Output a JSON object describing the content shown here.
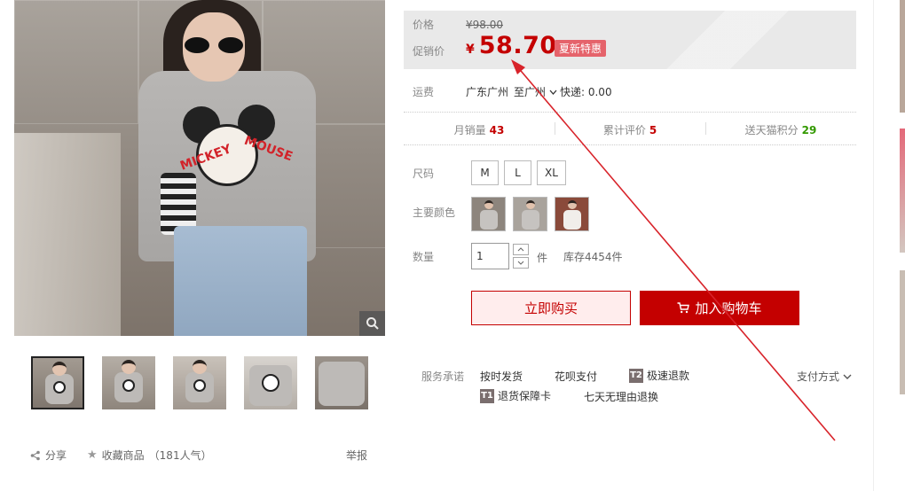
{
  "price": {
    "orig_label": "价格",
    "orig_value": "¥98.00",
    "promo_label": "促销价",
    "currency": "¥",
    "promo_value": "58.70",
    "promo_tag": "夏新特惠"
  },
  "shipping": {
    "label": "运费",
    "from": "广东广州",
    "to": "至广州",
    "express": "快递: 0.00"
  },
  "stats": [
    {
      "label": "月销量",
      "value": "43",
      "color": "#c40000"
    },
    {
      "label": "累计评价",
      "value": "5",
      "color": "#c40000"
    },
    {
      "label": "送天猫积分",
      "value": "29",
      "color": "#339900"
    }
  ],
  "size": {
    "label": "尺码",
    "options": [
      "M",
      "L",
      "XL"
    ]
  },
  "color": {
    "label": "主要颜色"
  },
  "quantity": {
    "label": "数量",
    "value": "1",
    "unit": "件",
    "stock": "库存4454件"
  },
  "actions": {
    "buy_now": "立即购买",
    "add_cart": "加入购物车"
  },
  "service": {
    "label": "服务承诺",
    "items": [
      "按时发货",
      "花呗支付",
      "极速退款",
      "退货保障卡",
      "七天无理由退换"
    ],
    "badge_t2": "T2",
    "badge_t1": "T1",
    "payment": "支付方式"
  },
  "share": {
    "share_label": "分享",
    "collect_label": "收藏商品",
    "popularity": "（181人气）",
    "report_label": "举报"
  },
  "colors": {
    "accent": "#c40000",
    "tag_bg": "#e5636b",
    "annotation": "#d8232a"
  }
}
